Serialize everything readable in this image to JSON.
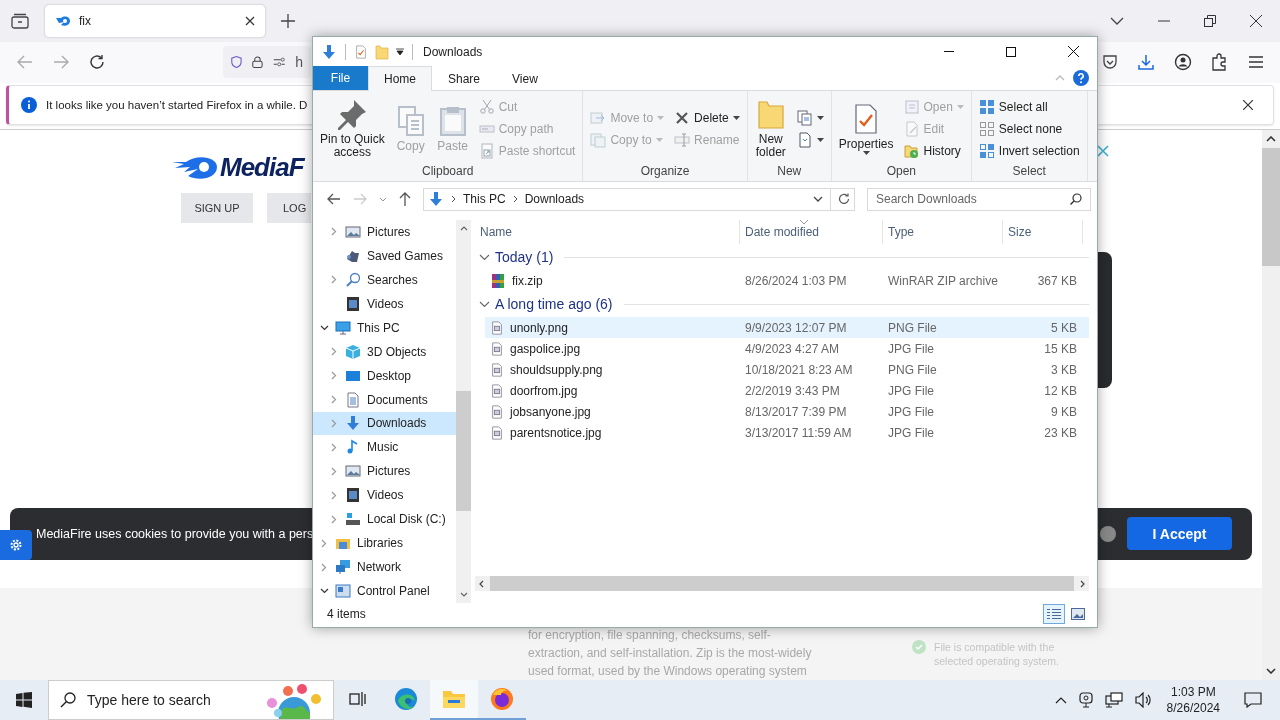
{
  "browser": {
    "tabs": [
      {
        "title": "fix",
        "selected": true
      }
    ],
    "url": "h",
    "notification": "It looks like you haven’t started Firefox in a while. D"
  },
  "page": {
    "logo": "MediaF",
    "buttons": [
      "SIGN UP",
      "LOG"
    ],
    "cookie_text": "MediaFire uses cookies to provide you with a pers",
    "accept": "I Accept",
    "description": "for encryption, file spanning, checksums, self-extraction, and self-installation. Zip is the most-widely used format, used by the Windows operating system",
    "compat_note": "File is compatible with the selected operating system."
  },
  "explorer": {
    "title": "Downloads",
    "ribbon_tabs": [
      {
        "label": "File",
        "kind": "file",
        "selected": false
      },
      {
        "label": "Home",
        "kind": "tab",
        "selected": true
      },
      {
        "label": "Share",
        "kind": "tab",
        "selected": false
      },
      {
        "label": "View",
        "kind": "tab",
        "selected": false
      }
    ],
    "ribbon_groups": [
      {
        "label": "Clipboard",
        "columns": [
          [
            {
              "lines": [
                "Pin to Quick",
                "access"
              ],
              "kind": "large",
              "disabled": false,
              "dropdown": false
            }
          ],
          [
            {
              "lines": [
                "Copy"
              ],
              "kind": "large",
              "disabled": true,
              "dropdown": false
            }
          ],
          [
            {
              "lines": [
                "Paste"
              ],
              "kind": "large",
              "disabled": true,
              "dropdown": false
            }
          ],
          [
            {
              "label": "Cut",
              "kind": "small",
              "disabled": true,
              "dropdown": false
            },
            {
              "label": "Copy path",
              "kind": "small",
              "disabled": true,
              "dropdown": false
            },
            {
              "label": "Paste shortcut",
              "kind": "small",
              "disabled": true,
              "dropdown": false
            }
          ]
        ]
      },
      {
        "label": "Organize",
        "columns": [
          [
            {
              "label": "Move to",
              "kind": "small",
              "disabled": true,
              "dropdown": true
            },
            {
              "label": "Copy to",
              "kind": "small",
              "disabled": true,
              "dropdown": true
            }
          ],
          [
            {
              "label": "Delete",
              "kind": "small",
              "disabled": false,
              "dropdown": true
            },
            {
              "label": "Rename",
              "kind": "small",
              "disabled": true,
              "dropdown": false
            }
          ]
        ]
      },
      {
        "label": "New",
        "columns": [
          [
            {
              "lines": [
                "New",
                "folder"
              ],
              "kind": "large",
              "disabled": false,
              "dropdown": false
            }
          ],
          [
            {
              "kind": "small",
              "disabled": false,
              "dropdown": true
            },
            {
              "kind": "small",
              "disabled": false,
              "dropdown": true
            }
          ]
        ]
      },
      {
        "label": "Open",
        "columns": [
          [
            {
              "lines": [
                "Properties"
              ],
              "kind": "large",
              "disabled": false,
              "dropdown": true
            }
          ],
          [
            {
              "label": "Open",
              "kind": "small",
              "disabled": true,
              "dropdown": true
            },
            {
              "label": "Edit",
              "kind": "small",
              "disabled": true,
              "dropdown": false
            },
            {
              "label": "History",
              "kind": "small",
              "disabled": false,
              "dropdown": false
            }
          ]
        ]
      },
      {
        "label": "Select",
        "columns": [
          [
            {
              "label": "Select all",
              "kind": "small",
              "disabled": false,
              "dropdown": false
            },
            {
              "label": "Select none",
              "kind": "small",
              "disabled": false,
              "dropdown": false
            },
            {
              "label": "Invert selection",
              "kind": "small",
              "disabled": false,
              "dropdown": false
            }
          ]
        ]
      }
    ],
    "address": [
      "This PC",
      "Downloads"
    ],
    "search_placeholder": "Search Downloads",
    "tree_continued": [
      {
        "label": "Pictures",
        "expanded": false,
        "selected": false
      },
      {
        "label": "Saved Games",
        "selected": false
      },
      {
        "label": "Searches",
        "expanded": false,
        "selected": false
      },
      {
        "label": "Videos",
        "selected": false
      }
    ],
    "tree": [
      {
        "label": "This PC",
        "expanded": true,
        "selected": false,
        "children": [
          {
            "label": "3D Objects",
            "expanded": false,
            "selected": false
          },
          {
            "label": "Desktop",
            "expanded": false,
            "selected": false
          },
          {
            "label": "Documents",
            "expanded": false,
            "selected": false
          },
          {
            "label": "Downloads",
            "expanded": false,
            "selected": true
          },
          {
            "label": "Music",
            "expanded": false,
            "selected": false
          },
          {
            "label": "Pictures",
            "expanded": false,
            "selected": false
          },
          {
            "label": "Videos",
            "expanded": false,
            "selected": false
          },
          {
            "label": "Local Disk (C:)",
            "expanded": false,
            "selected": false
          }
        ]
      },
      {
        "label": "Libraries",
        "expanded": false,
        "selected": false
      },
      {
        "label": "Network",
        "expanded": false,
        "selected": false
      },
      {
        "label": "Control Panel",
        "expanded": true,
        "selected": false
      }
    ],
    "columns": [
      {
        "label": "Name",
        "sorted": false
      },
      {
        "label": "Date modified",
        "sorted": true
      },
      {
        "label": "Type",
        "sorted": false
      },
      {
        "label": "Size",
        "sorted": false
      }
    ],
    "groups": [
      {
        "label": "Today (1)",
        "expanded": true,
        "files": [
          {
            "name": "fix.zip",
            "kind": "archive",
            "date": "8/26/2024 1:03 PM",
            "type": "WinRAR ZIP archive",
            "size": "367 KB",
            "selected": false
          }
        ]
      },
      {
        "label": "A long time ago (6)",
        "expanded": true,
        "files": [
          {
            "name": "unonly.png",
            "kind": "image",
            "date": "9/9/2023 12:07 PM",
            "type": "PNG File",
            "size": "5 KB",
            "selected": true
          },
          {
            "name": "gaspolice.jpg",
            "kind": "image",
            "date": "4/9/2023 4:27 AM",
            "type": "JPG File",
            "size": "15 KB",
            "selected": false
          },
          {
            "name": "shouldsupply.png",
            "kind": "image",
            "date": "10/18/2021 8:23 AM",
            "type": "PNG File",
            "size": "3 KB",
            "selected": false
          },
          {
            "name": "doorfrom.jpg",
            "kind": "image",
            "date": "2/2/2019 3:43 PM",
            "type": "JPG File",
            "size": "12 KB",
            "selected": false
          },
          {
            "name": "jobsanyone.jpg",
            "kind": "image",
            "date": "8/13/2017 7:39 PM",
            "type": "JPG File",
            "size": "9 KB",
            "selected": false
          },
          {
            "name": "parentsnotice.jpg",
            "kind": "image",
            "date": "3/13/2017 11:59 AM",
            "type": "JPG File",
            "size": "23 KB",
            "selected": false
          }
        ]
      }
    ],
    "status": "4 items",
    "view_buttons": [
      {
        "selected": true
      },
      {
        "selected": false
      }
    ]
  },
  "taskbar": {
    "search_placeholder": "Type here to search",
    "apps": [
      {
        "running": false,
        "selected": false
      },
      {
        "running": false,
        "selected": false
      },
      {
        "running": true,
        "selected": true
      },
      {
        "running": true,
        "selected": false
      }
    ],
    "time": "1:03 PM",
    "date": "8/26/2024"
  }
}
